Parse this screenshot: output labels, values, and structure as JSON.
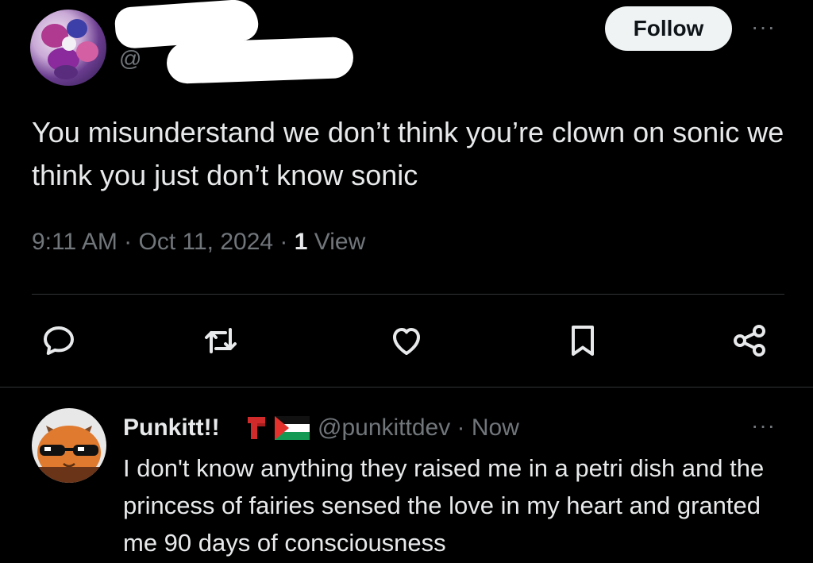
{
  "tweet": {
    "handle_prefix": "@",
    "follow_label": "Follow",
    "more_label": "···",
    "text": "You misunderstand we don’t think you’re clown on sonic we think you just don’t know sonic",
    "time": "9:11 AM",
    "separator": " · ",
    "date": "Oct 11, 2024",
    "view_count": "1",
    "view_label": "View",
    "actions": [
      "reply-icon",
      "retweet-icon",
      "like-icon",
      "bookmark-icon",
      "share-icon"
    ]
  },
  "reply": {
    "display_name": "Punkitt!!",
    "emoji": [
      "red-scarf-emoji",
      "palestine-flag-emoji"
    ],
    "handle": "@punkittdev",
    "time": " · Now",
    "more_label": "···",
    "text": "I don't know anything they raised me in a petri dish and the princess of fairies sensed the love in my heart and granted me 90 days of consciousness"
  },
  "colors": {
    "background": "#000000",
    "text": "#e7e9ea",
    "muted": "#71767b",
    "divider": "#2f3336",
    "follow_bg": "#eff3f4"
  }
}
